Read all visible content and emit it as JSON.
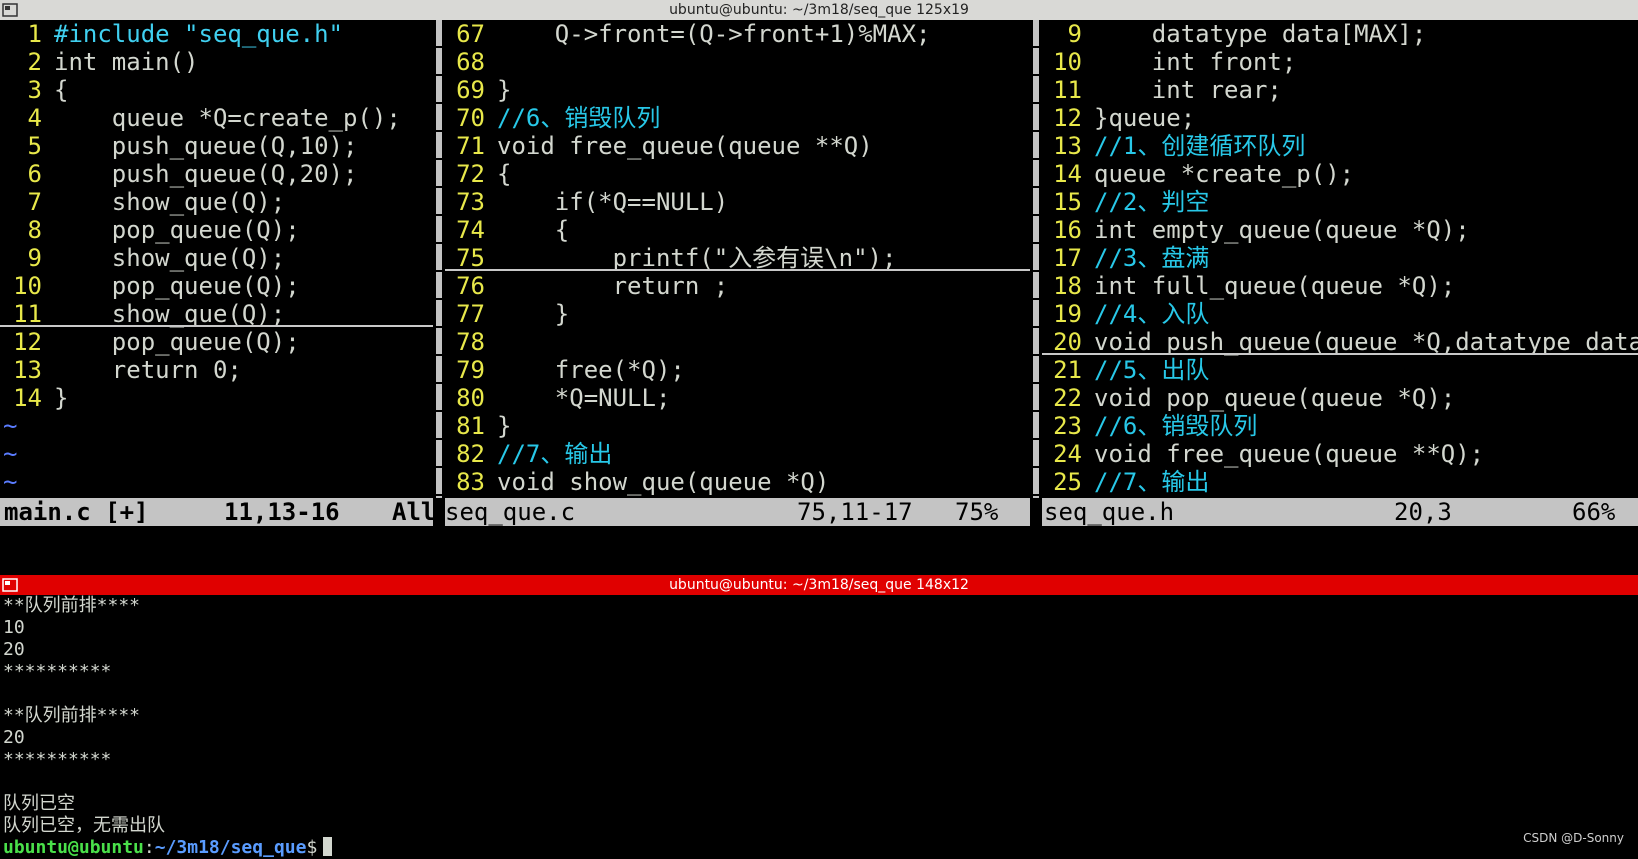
{
  "top_window": {
    "title": "ubuntu@ubuntu: ~/3m18/seq_que 125x19"
  },
  "bottom_window": {
    "title": "ubuntu@ubuntu: ~/3m18/seq_que 148x12"
  },
  "panes": {
    "left": {
      "lines": [
        {
          "n": "1",
          "t": "#include \"seq_que.h\""
        },
        {
          "n": "2",
          "t": "int main()"
        },
        {
          "n": "3",
          "t": "{"
        },
        {
          "n": "4",
          "t": "    queue *Q=create_p();"
        },
        {
          "n": "5",
          "t": "    push_queue(Q,10);"
        },
        {
          "n": "6",
          "t": "    push_queue(Q,20);"
        },
        {
          "n": "7",
          "t": "    show_que(Q);"
        },
        {
          "n": "8",
          "t": "    pop_queue(Q);"
        },
        {
          "n": "9",
          "t": "    show_que(Q);"
        },
        {
          "n": "10",
          "t": "    pop_queue(Q);"
        },
        {
          "n": "11",
          "t": "    show_que(Q);"
        },
        {
          "n": "12",
          "t": "    pop_queue(Q);"
        },
        {
          "n": "13",
          "t": "    return 0;"
        },
        {
          "n": "14",
          "t": "}"
        }
      ],
      "tilde": "~",
      "status": {
        "name": "main.c [+]",
        "pos": "11,13-16",
        "pct": "All"
      }
    },
    "mid": {
      "lines": [
        {
          "n": "67",
          "t": "    Q->front=(Q->front+1)%MAX;"
        },
        {
          "n": "68",
          "t": ""
        },
        {
          "n": "69",
          "t": "}"
        },
        {
          "n": "70",
          "t": "//6、销毁队列"
        },
        {
          "n": "71",
          "t": "void free_queue(queue **Q)"
        },
        {
          "n": "72",
          "t": "{"
        },
        {
          "n": "73",
          "t": "    if(*Q==NULL)"
        },
        {
          "n": "74",
          "t": "    {"
        },
        {
          "n": "75",
          "t": "        printf(\"入参有误\\n\");"
        },
        {
          "n": "76",
          "t": "        return ;"
        },
        {
          "n": "77",
          "t": "    }"
        },
        {
          "n": "78",
          "t": ""
        },
        {
          "n": "79",
          "t": "    free(*Q);"
        },
        {
          "n": "80",
          "t": "    *Q=NULL;"
        },
        {
          "n": "81",
          "t": "}"
        },
        {
          "n": "82",
          "t": "//7、输出"
        },
        {
          "n": "83",
          "t": "void show_que(queue *Q)"
        }
      ],
      "status": {
        "name": "seq_que.c",
        "pos": "75,11-17",
        "pct": "75%"
      }
    },
    "right": {
      "lines": [
        {
          "n": "9",
          "t": "    datatype data[MAX];"
        },
        {
          "n": "10",
          "t": "    int front;"
        },
        {
          "n": "11",
          "t": "    int rear;"
        },
        {
          "n": "12",
          "t": "}queue;"
        },
        {
          "n": "13",
          "t": "//1、创建循环队列"
        },
        {
          "n": "14",
          "t": "queue *create_p();"
        },
        {
          "n": "15",
          "t": "//2、判空"
        },
        {
          "n": "16",
          "t": "int empty_queue(queue *Q);"
        },
        {
          "n": "17",
          "t": "//3、盘满"
        },
        {
          "n": "18",
          "t": "int full_queue(queue *Q);"
        },
        {
          "n": "19",
          "t": "//4、入队"
        },
        {
          "n": "20",
          "t": "void push_queue(queue *Q,datatype data);"
        },
        {
          "n": "21",
          "t": "//5、出队"
        },
        {
          "n": "22",
          "t": "void pop_queue(queue *Q);"
        },
        {
          "n": "23",
          "t": "//6、销毁队列"
        },
        {
          "n": "24",
          "t": "void free_queue(queue **Q);"
        },
        {
          "n": "25",
          "t": "//7、输出"
        }
      ],
      "status": {
        "name": "seq_que.h",
        "pos": "20,3",
        "pct": "66%"
      }
    }
  },
  "terminal": {
    "lines": [
      "**队列前排****",
      "10",
      "20",
      "**********",
      "",
      "**队列前排****",
      "20",
      "**********",
      "",
      "队列已空",
      "队列已空，无需出队"
    ],
    "prompt_user": "ubuntu@ubuntu",
    "prompt_sep": ":",
    "prompt_path": "~/3m18/seq_que",
    "prompt_symbol": "$"
  },
  "watermark": "CSDN @D-Sonny",
  "colors": {
    "bottom_title_bg": "#e00000",
    "line_number": "#e8e84a",
    "comment": "#28c8e8",
    "type": "#4ae04a"
  }
}
